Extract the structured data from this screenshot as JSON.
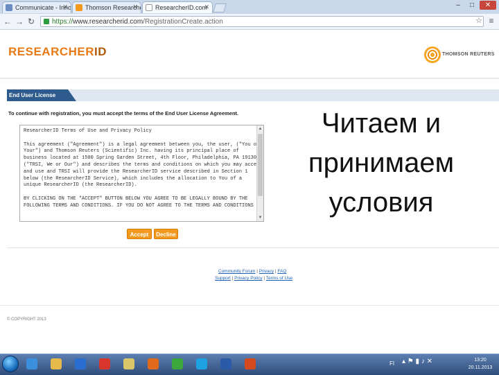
{
  "browser": {
    "tabs": [
      {
        "label": "Communicate - Innoval",
        "icon_color": "#6b8cc0",
        "active": false
      },
      {
        "label": "Thomson ResearcherID - I",
        "icon_color": "#f39a1e",
        "active": false
      },
      {
        "label": "ResearcherID.com",
        "icon_color": "#ffffff",
        "active": true
      }
    ],
    "window_controls": {
      "minimize": "–",
      "maximize": "□",
      "close": "✕"
    },
    "nav": {
      "back": "←",
      "forward": "→",
      "reload": "↻",
      "star": "☆",
      "menu": "≡"
    },
    "address": {
      "scheme": "https://",
      "host": "www.researcherid.com",
      "path": "/RegistrationCreate.action"
    }
  },
  "header": {
    "logo_main": "RESEARCHER",
    "logo_id": "ID",
    "partner_logo_text": "THOMSON REUTERS"
  },
  "section": {
    "title": "End User License",
    "instruction": "To continue with registration, you must accept the terms of the End User License Agreement."
  },
  "license": {
    "text": "ResearcherID Terms of Use and Privacy Policy\n\nThis agreement (\"Agreement\") is a legal agreement between you, the user, (\"You or\nYour\") and Thomson Reuters (Scientific) Inc. having its principal place of\nbusiness located at 1500 Spring Garden Street, 4th Floor, Philadelphia, PA 19130\n(\"TRSI, We or Our\") and describes the terms and conditions on which you may access\nand use and TRSI will provide the ResearcherID service described in Section 1\nbelow (the ResearcherID Service), which includes the allocation to You of a\nunique ResearcherID (the ResearcherID).\n\nBY CLICKING ON THE \"ACCEPT\" BUTTON BELOW YOU AGREE TO BE LEGALLY BOUND BY THE\nFOLLOWING TERMS AND CONDITIONS. IF YOU DO NOT AGREE TO THE TERMS AND CONDITIONS"
  },
  "buttons": {
    "accept": "Accept",
    "decline": "Decline"
  },
  "footer": {
    "row1": [
      "Community Forum",
      "Privacy",
      "FAQ"
    ],
    "row2": [
      "Support",
      "Privacy Policy",
      "Terms of Use"
    ],
    "separator": "|",
    "copyright": "© COPYRIGHT 2013"
  },
  "caption": {
    "line1": "Читаем и",
    "line2": "принимаем",
    "line3": "условия"
  },
  "taskbar": {
    "apps": [
      {
        "name": "ie",
        "color": "#3b8fdc"
      },
      {
        "name": "explorer",
        "color": "#e5b94a"
      },
      {
        "name": "media-player",
        "color": "#2a6dd1"
      },
      {
        "name": "chrome",
        "color": "#d8362c"
      },
      {
        "name": "notes",
        "color": "#d9c56a"
      },
      {
        "name": "firefox",
        "color": "#e06a1b"
      },
      {
        "name": "icq",
        "color": "#3ba63b"
      },
      {
        "name": "skype",
        "color": "#1da1e0"
      },
      {
        "name": "word",
        "color": "#2b5aa8"
      },
      {
        "name": "powerpoint",
        "color": "#d44a1e"
      }
    ],
    "language": "FI",
    "tray_icons": "▴ ⚑ ▮ ♪ ✕",
    "time": "13:20",
    "date": "20.11.2013"
  }
}
